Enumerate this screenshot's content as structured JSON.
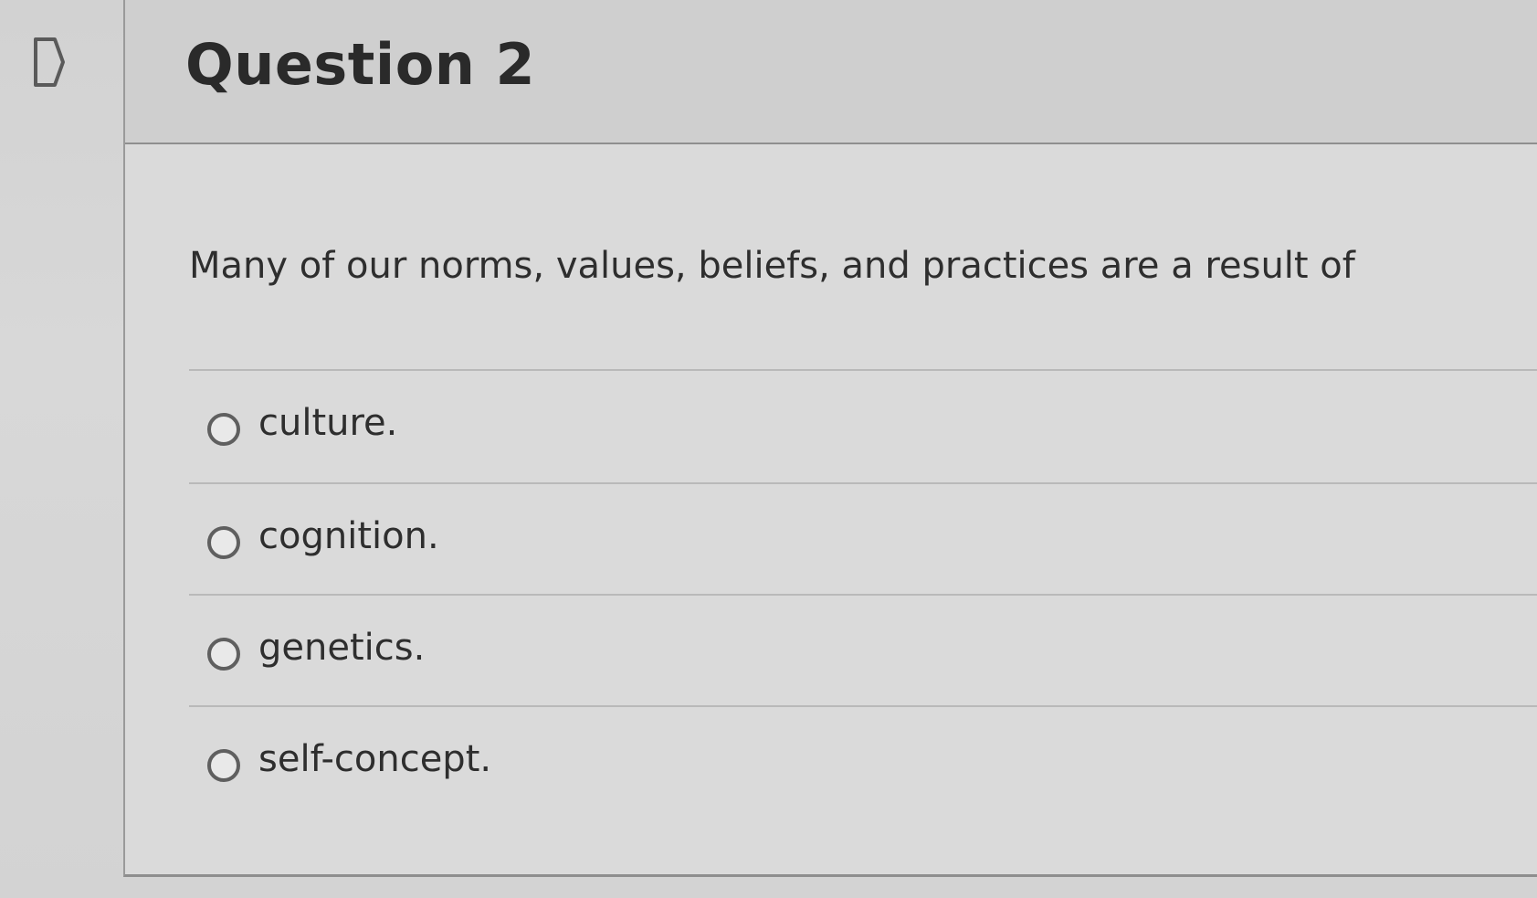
{
  "question": {
    "title": "Question 2",
    "prompt": "Many of our norms, values, beliefs, and practices are a result of",
    "options": [
      {
        "label": "culture."
      },
      {
        "label": "cognition."
      },
      {
        "label": "genetics."
      },
      {
        "label": "self-concept."
      }
    ]
  },
  "icons": {
    "flag": "flag-question-icon",
    "radio": "radio-unselected-icon"
  },
  "colors": {
    "background": "#d3d3d3",
    "text": "#2d2d2d",
    "border": "#8f8f8f"
  }
}
